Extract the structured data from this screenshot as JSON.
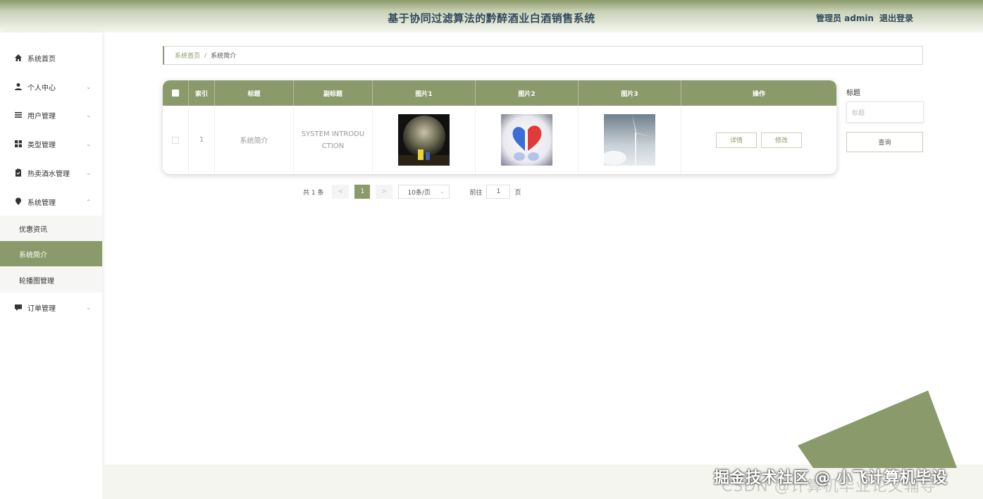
{
  "header": {
    "title": "基于协同过滤算法的黔醉酒业白酒销售系统",
    "user": "管理员 admin",
    "logout": "退出登录"
  },
  "sidebar": {
    "items": [
      {
        "label": "系统首页",
        "icon": "home-icon"
      },
      {
        "label": "个人中心",
        "icon": "user-icon",
        "expanded": false
      },
      {
        "label": "用户管理",
        "icon": "list-icon",
        "expanded": false
      },
      {
        "label": "类型管理",
        "icon": "grid-icon",
        "expanded": false
      },
      {
        "label": "热卖酒水管理",
        "icon": "clipboard-icon",
        "expanded": false
      },
      {
        "label": "系统管理",
        "icon": "location-pin-icon",
        "expanded": true
      },
      {
        "label": "订单管理",
        "icon": "chat-icon",
        "expanded": false
      }
    ],
    "sub_items": [
      {
        "label": "优惠资讯",
        "active": false
      },
      {
        "label": "系统简介",
        "active": true
      },
      {
        "label": "轮播图管理",
        "active": false
      }
    ]
  },
  "breadcrumb": {
    "home": "系统首页",
    "separator": "/",
    "current": "系统简介"
  },
  "table": {
    "columns": [
      "索引",
      "标题",
      "副标题",
      "图片1",
      "图片2",
      "图片3",
      "操作"
    ],
    "rows": [
      {
        "index": "1",
        "title": "系统简介",
        "subtitle": "SYSTEM INTRODUCTION",
        "images": [
          "earth-photo",
          "hearts-photo",
          "wind-turbine-photo"
        ],
        "actions": [
          "详情",
          "修改"
        ]
      }
    ]
  },
  "search": {
    "label": "标题",
    "placeholder": "标题",
    "button": "查询"
  },
  "pagination": {
    "total": "共 1 条",
    "prev": "<",
    "current": "1",
    "next": ">",
    "page_size": "10条/页",
    "goto_prefix": "前往",
    "goto_value": "1",
    "goto_suffix": "页"
  },
  "watermarks": {
    "primary": "掘金技术社区 @ 小飞计算机毕设",
    "secondary": "CSDN @计算机毕业论文辅导"
  },
  "colors": {
    "accent": "#8a9a6a",
    "header_text": "#2f4a5a"
  }
}
